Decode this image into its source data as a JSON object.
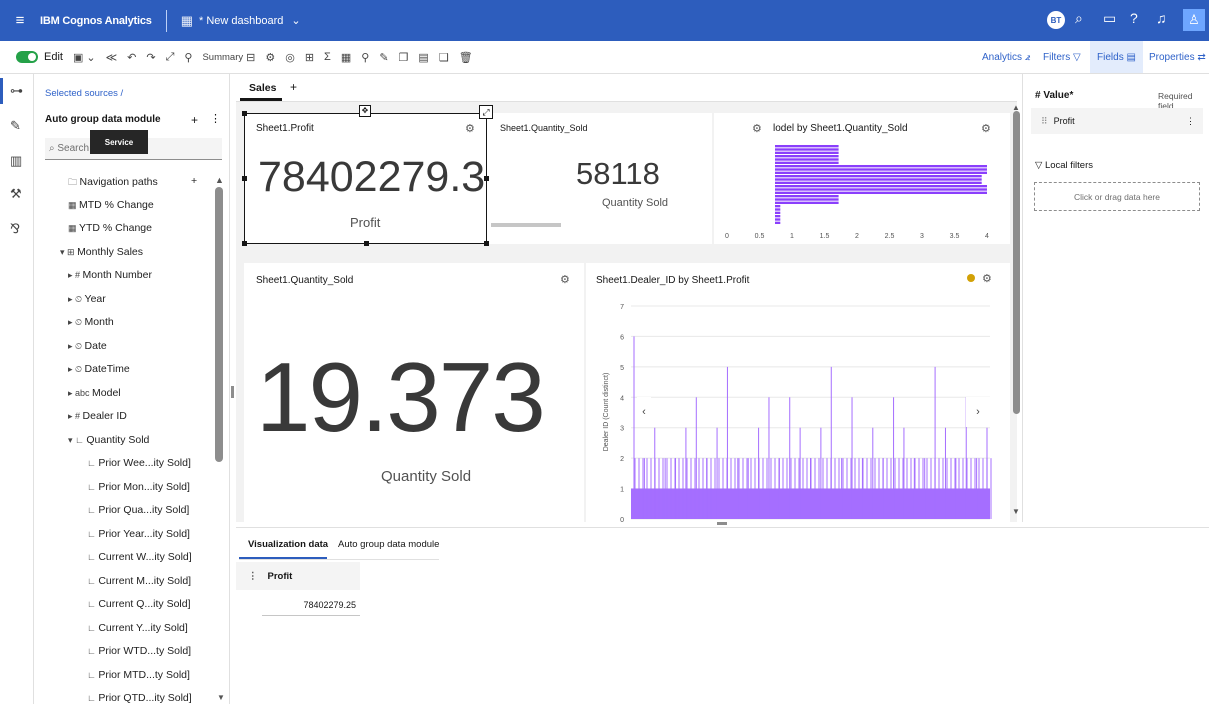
{
  "topbar": {
    "app_name": "IBM Cognos Analytics",
    "dashboard_name": "* New dashboard",
    "avatar_initials": "BT"
  },
  "toolbar": {
    "edit_label": "Edit",
    "summary_label": "Summary",
    "analytics_label": "Analytics",
    "filters_label": "Filters",
    "fields_label": "Fields",
    "properties_label": "Properties"
  },
  "sidepanel": {
    "sources_breadcrumb": "Selected sources  /",
    "module_name": "Auto group data module",
    "tooltip": "Service",
    "search_placeholder": "Search",
    "tree": [
      {
        "icon": "🗀",
        "label": "Navigation paths",
        "indent": 0
      },
      {
        "icon": "▦",
        "label": "MTD % Change",
        "indent": 0
      },
      {
        "icon": "▦",
        "label": "YTD % Change",
        "indent": 0
      },
      {
        "icon": "▾ ⊞",
        "label": "Monthly Sales",
        "indent": -1
      },
      {
        "icon": "▸ #",
        "label": "Month Number",
        "indent": 1
      },
      {
        "icon": "▸ ⏲",
        "label": "Year",
        "indent": 1
      },
      {
        "icon": "▸ ⏲",
        "label": "Month",
        "indent": 1
      },
      {
        "icon": "▸ ⏲",
        "label": "Date",
        "indent": 1
      },
      {
        "icon": "▸ ⏲",
        "label": "DateTime",
        "indent": 1
      },
      {
        "icon": "▸ abc",
        "label": "Model",
        "indent": 1
      },
      {
        "icon": "▸ #",
        "label": "Dealer ID",
        "indent": 1
      },
      {
        "icon": "▾ ∟",
        "label": "Quantity Sold",
        "indent": 1
      },
      {
        "icon": "∟",
        "label": "Prior Wee...ity Sold]",
        "indent": 2
      },
      {
        "icon": "∟",
        "label": "Prior Mon...ity Sold]",
        "indent": 2
      },
      {
        "icon": "∟",
        "label": "Prior Qua...ity Sold]",
        "indent": 2
      },
      {
        "icon": "∟",
        "label": "Prior Year...ity Sold]",
        "indent": 2
      },
      {
        "icon": "∟",
        "label": "Current W...ity Sold]",
        "indent": 2
      },
      {
        "icon": "∟",
        "label": "Current M...ity Sold]",
        "indent": 2
      },
      {
        "icon": "∟",
        "label": "Current Q...ity Sold]",
        "indent": 2
      },
      {
        "icon": "∟",
        "label": "Current Y...ity Sold]",
        "indent": 2
      },
      {
        "icon": "∟",
        "label": "Prior WTD...ty Sold]",
        "indent": 2
      },
      {
        "icon": "∟",
        "label": "Prior MTD...ty Sold]",
        "indent": 2
      },
      {
        "icon": "∟",
        "label": "Prior QTD...ity Sold]",
        "indent": 2
      }
    ]
  },
  "tabs": {
    "active": "Sales",
    "add": "+"
  },
  "cards": {
    "profit": {
      "title": "Sheet1.Profit",
      "value": "78402279.3",
      "label": "Profit"
    },
    "qty_small": {
      "title": "Sheet1.Quantity_Sold",
      "value": "58118",
      "label": "Quantity Sold"
    },
    "histogram": {
      "title": "lodel by Sheet1.Quantity_Sold",
      "x_ticks": [
        "0",
        "0.5",
        "1",
        "1.5",
        "2",
        "2.5",
        "3",
        "3.5",
        "4"
      ]
    },
    "qty_big": {
      "title": "Sheet1.Quantity_Sold",
      "value": "19.373",
      "label": "Quantity Sold"
    },
    "dealer": {
      "title": "Sheet1.Dealer_ID by Sheet1.Profit",
      "y_label": "Dealer ID (Count distinct)",
      "y_ticks": [
        "0",
        "1",
        "2",
        "3",
        "4",
        "5",
        "6",
        "7"
      ]
    }
  },
  "chart_data": [
    {
      "type": "bar",
      "title": "lodel by Sheet1.Quantity_Sold",
      "orientation": "horizontal",
      "xlim": [
        0,
        4
      ],
      "values": [
        1.2,
        1.2,
        4,
        3.9,
        4,
        1.2,
        0.1,
        0.1
      ],
      "color": "#8a3ffc"
    },
    {
      "type": "bar",
      "title": "Sheet1.Dealer_ID by Sheet1.Profit",
      "ylabel": "Dealer ID (Count distinct)",
      "ylim": [
        0,
        7
      ],
      "baseline_value": 1,
      "spikes": [
        6,
        2,
        3,
        2,
        2,
        3,
        4,
        2,
        3,
        5,
        2,
        2,
        3,
        4,
        2,
        4,
        3,
        2,
        3,
        5,
        2,
        4,
        2,
        3,
        2,
        4,
        3,
        2,
        2,
        5,
        3,
        2,
        4,
        2,
        3
      ],
      "color": "#a56eff"
    }
  ],
  "right_panel": {
    "value_label": "# Value*",
    "required": "Required field",
    "field": "Profit",
    "local_filters": "Local filters",
    "drop_hint": "Click or drag data here"
  },
  "bottom": {
    "tab_viz": "Visualization data",
    "tab_module": "Auto group data module",
    "col_header": "Profit",
    "cell_value": "78402279.25"
  }
}
